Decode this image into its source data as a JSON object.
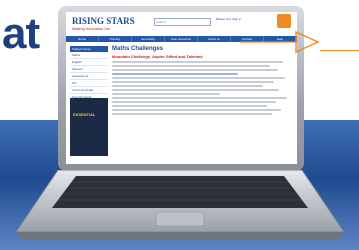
{
  "headline": "at",
  "website": {
    "logo": "RISING STARS",
    "logo_sub": "Making education fun",
    "search_placeholder": "Search",
    "header_links": "Basket (0) | Sign in",
    "nav": [
      "Home",
      "Primary",
      "Secondary",
      "Free resources",
      "About us",
      "Contact",
      "Help"
    ],
    "side_title": "Subject Areas",
    "side_items": [
      "Maths",
      "English",
      "Science",
      "Assessment",
      "ICT",
      "Cross-curricular",
      "Special Needs"
    ],
    "ad_text": "ESSENTIAL",
    "main_title": "Maths Challenges",
    "main_subtitle": "Mountain Challenge, Aspire Gifted and Talented"
  },
  "colors": {
    "brand_blue": "#2457a6",
    "accent_orange": "#f08a24",
    "band_blue": "#1f4a8f"
  }
}
